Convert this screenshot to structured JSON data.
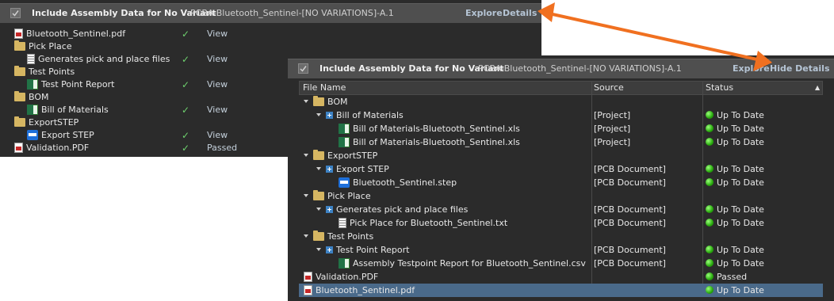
{
  "panel_a": {
    "header": {
      "title": "Include Assembly Data for No Variant",
      "subtitle": "PCBA-Bluetooth_Sentinel-[NO VARIATIONS]-A.1",
      "explore": "Explore",
      "details": "Details"
    },
    "rows": [
      {
        "label": "Bluetooth_Sentinel.pdf",
        "icon": "pdf-icon",
        "check": "✓",
        "action": "View"
      },
      {
        "label": "Pick Place",
        "icon": "folder-icon",
        "check": "",
        "action": ""
      },
      {
        "label": "Generates pick and place files",
        "icon": "document-icon",
        "check": "✓",
        "action": "View"
      },
      {
        "label": "Test Points",
        "icon": "folder-icon",
        "check": "",
        "action": ""
      },
      {
        "label": "Test Point Report",
        "icon": "excel-icon",
        "check": "✓",
        "action": "View"
      },
      {
        "label": "BOM",
        "icon": "folder-icon",
        "check": "",
        "action": ""
      },
      {
        "label": "Bill of Materials",
        "icon": "excel-icon",
        "check": "✓",
        "action": "View"
      },
      {
        "label": "ExportSTEP",
        "icon": "folder-icon",
        "check": "",
        "action": ""
      },
      {
        "label": "Export STEP",
        "icon": "step-icon",
        "check": "✓",
        "action": "View"
      },
      {
        "label": "Validation.PDF",
        "icon": "pdf-icon",
        "check": "✓",
        "action": "Passed"
      }
    ]
  },
  "panel_b": {
    "header": {
      "title": "Include Assembly Data for No Variant",
      "subtitle": "PCBA-Bluetooth_Sentinel-[NO VARIATIONS]-A.1",
      "explore": "Explore",
      "hide_details": "Hide Details"
    },
    "columns": {
      "file_name": "File Name",
      "source": "Source",
      "status": "Status"
    },
    "rows": [
      {
        "name": "BOM",
        "source": "",
        "status": "",
        "icon": "folder-icon",
        "indent": 0,
        "expander": "tri"
      },
      {
        "name": "Bill of Materials",
        "source": "[Project]",
        "status": "Up To Date",
        "icon": "",
        "indent": 1,
        "expander": "tri-plus"
      },
      {
        "name": "Bill of Materials-Bluetooth_Sentinel.xls",
        "source": "[Project]",
        "status": "Up To Date",
        "icon": "excel-icon",
        "indent": 2,
        "expander": ""
      },
      {
        "name": "Bill of Materials-Bluetooth_Sentinel.xls",
        "source": "[Project]",
        "status": "Up To Date",
        "icon": "excel-icon",
        "indent": 2,
        "expander": ""
      },
      {
        "name": "ExportSTEP",
        "source": "",
        "status": "",
        "icon": "folder-icon",
        "indent": 0,
        "expander": "tri"
      },
      {
        "name": "Export STEP",
        "source": "[PCB Document]",
        "status": "Up To Date",
        "icon": "",
        "indent": 1,
        "expander": "tri-plus"
      },
      {
        "name": "Bluetooth_Sentinel.step",
        "source": "[PCB Document]",
        "status": "Up To Date",
        "icon": "step-icon",
        "indent": 2,
        "expander": ""
      },
      {
        "name": "Pick Place",
        "source": "",
        "status": "",
        "icon": "folder-icon",
        "indent": 0,
        "expander": "tri"
      },
      {
        "name": "Generates pick and place files",
        "source": "[PCB Document]",
        "status": "Up To Date",
        "icon": "",
        "indent": 1,
        "expander": "tri-plus"
      },
      {
        "name": "Pick Place for Bluetooth_Sentinel.txt",
        "source": "[PCB Document]",
        "status": "Up To Date",
        "icon": "document-icon",
        "indent": 2,
        "expander": ""
      },
      {
        "name": "Test Points",
        "source": "",
        "status": "",
        "icon": "folder-icon",
        "indent": 0,
        "expander": "tri"
      },
      {
        "name": "Test Point Report",
        "source": "[PCB Document]",
        "status": "Up To Date",
        "icon": "",
        "indent": 1,
        "expander": "tri-plus"
      },
      {
        "name": "Assembly Testpoint Report for Bluetooth_Sentinel.csv",
        "source": "[PCB Document]",
        "status": "Up To Date",
        "icon": "excel-icon",
        "indent": 2,
        "expander": ""
      },
      {
        "name": "Validation.PDF",
        "source": "",
        "status": "Passed",
        "icon": "pdf-icon",
        "indent": 0,
        "expander": ""
      },
      {
        "name": "Bluetooth_Sentinel.pdf",
        "source": "",
        "status": "Up To Date",
        "icon": "pdf-icon",
        "indent": 0,
        "expander": "",
        "selected": true
      }
    ]
  },
  "colors": {
    "panel_bg": "#2b2b2b",
    "header_bg": "#4f4f4f",
    "check_green": "#6ed16e",
    "link": "#b5c4d4",
    "arrow": "#f07020",
    "selection": "#4a6a8a"
  }
}
